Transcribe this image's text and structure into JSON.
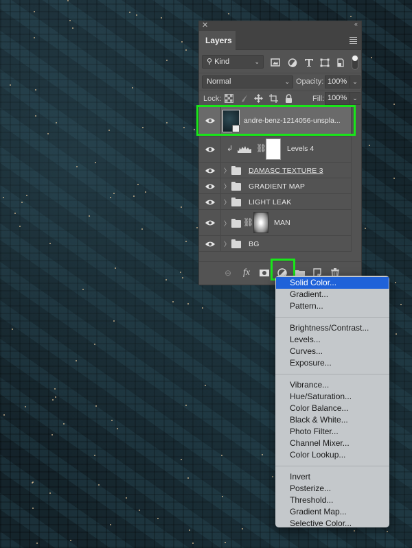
{
  "panel": {
    "tab_label": "Layers",
    "close_icon": "close-icon",
    "collapse_icon": "double-chevron-left-icon",
    "menu_icon": "hamburger-menu-icon",
    "filter": {
      "kind_label": "Kind",
      "icons": [
        "image-filter-icon",
        "adjustment-filter-icon",
        "type-filter-icon",
        "shape-filter-icon",
        "smart-object-filter-icon"
      ]
    },
    "blend_mode": "Normal",
    "opacity_label": "Opacity:",
    "opacity_value": "100%",
    "lock_label": "Lock:",
    "lock_icons": [
      "lock-transparent-pixels-icon",
      "lock-image-pixels-icon",
      "lock-position-icon",
      "lock-artboard-icon",
      "lock-all-icon"
    ],
    "fill_label": "Fill:",
    "fill_value": "100%"
  },
  "layers": [
    {
      "name": "andre-benz-1214056-unspla...",
      "type": "smart-object",
      "visible": true,
      "selected": true
    },
    {
      "name": "Levels 4",
      "type": "adjustment-levels",
      "visible": true,
      "clipped": true
    },
    {
      "name": "DAMASC TEXTURE 3",
      "type": "group",
      "visible": true,
      "underlined": true
    },
    {
      "name": "GRADIENT MAP",
      "type": "group",
      "visible": true
    },
    {
      "name": "LIGHT LEAK",
      "type": "group",
      "visible": true
    },
    {
      "name": "MAN",
      "type": "group-with-mask",
      "visible": true
    },
    {
      "name": "BG",
      "type": "group",
      "visible": true
    }
  ],
  "toolbar": {
    "buttons": [
      "link-layers",
      "add-layer-style",
      "add-mask",
      "new-fill-adjustment-layer",
      "new-group",
      "new-layer",
      "delete-layer"
    ],
    "fx_label": "fx"
  },
  "menu": {
    "groups": [
      [
        "Solid Color...",
        "Gradient...",
        "Pattern..."
      ],
      [
        "Brightness/Contrast...",
        "Levels...",
        "Curves...",
        "Exposure..."
      ],
      [
        "Vibrance...",
        "Hue/Saturation...",
        "Color Balance...",
        "Black & White...",
        "Photo Filter...",
        "Channel Mixer...",
        "Color Lookup..."
      ],
      [
        "Invert",
        "Posterize...",
        "Threshold...",
        "Gradient Map...",
        "Selective Color..."
      ]
    ],
    "highlighted": "Solid Color..."
  },
  "colors": {
    "highlight_green": "#19e619",
    "menu_selection": "#1f62d9",
    "panel_bg": "#535353"
  }
}
